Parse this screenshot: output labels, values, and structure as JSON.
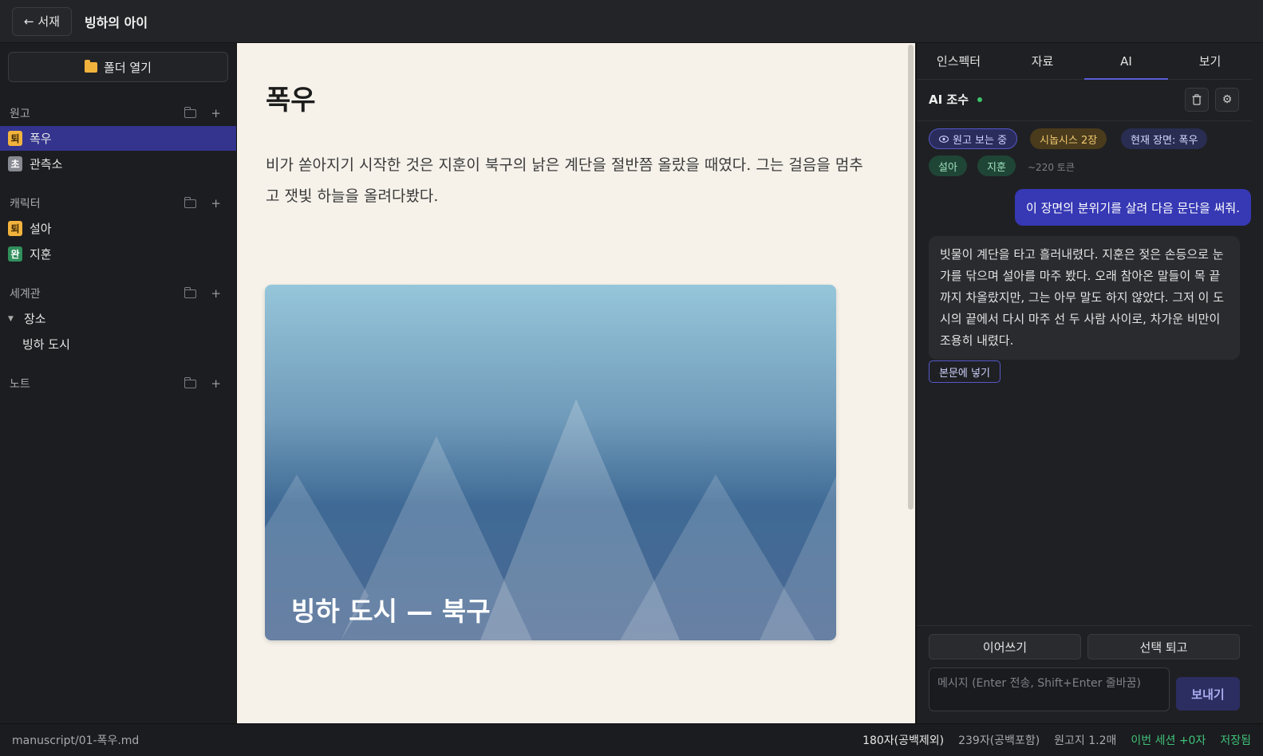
{
  "topbar": {
    "back_label": "← 서재",
    "title": "빙하의 아이"
  },
  "sidebar": {
    "open_folder_label": "폴더 열기",
    "sections": {
      "manuscript": {
        "label": "원고",
        "items": [
          {
            "badge": "퇴",
            "label": "폭우"
          },
          {
            "badge": "초",
            "label": "관측소"
          }
        ]
      },
      "characters": {
        "label": "캐릭터",
        "items": [
          {
            "badge": "퇴",
            "label": "설아"
          },
          {
            "badge": "완",
            "label": "지훈"
          }
        ]
      },
      "world": {
        "label": "세계관",
        "group": "장소",
        "child": "빙하 도시"
      },
      "notes": {
        "label": "노트"
      }
    },
    "plus": "+"
  },
  "editor": {
    "chapter_title": "폭우",
    "paragraph": "비가 쏟아지기 시작한 것은 지훈이 북구의 낡은 계단을 절반쯤 올랐을 때였다. 그는 걸음을 멈추고 잿빛 하늘을 올려다봤다.",
    "image_caption": "빙하 도시 — 북구"
  },
  "rpanel": {
    "tabs": [
      "인스펙터",
      "자료",
      "AI",
      "보기"
    ],
    "active_tab": "AI",
    "ai_title": "AI 조수",
    "chips": {
      "viewing": "원고 보는 중",
      "synopsis": "시놉시스 2장",
      "scene": "현재 장면: 폭우",
      "char1": "설아",
      "char2": "지훈"
    },
    "tokens": "~220 토큰",
    "user_message": "이 장면의 분위기를 살려 다음 문단을 써줘.",
    "ai_message": "빗물이 계단을 타고 흘러내렸다. 지훈은 젖은 손등으로 눈가를 닦으며 설아를 마주 봤다. 오래 참아온 말들이 목 끝까지 차올랐지만, 그는 아무 말도 하지 않았다. 그저 이 도시의 끝에서 다시 마주 선 두 사람 사이로, 차가운 비만이 조용히 내렸다.",
    "insert_label": "본문에 넣기",
    "continue_label": "이어쓰기",
    "revise_label": "선택 퇴고",
    "input_placeholder": "메시지 (Enter 전송, Shift+Enter 줄바꿈)",
    "send_label": "보내기"
  },
  "status": {
    "path": "manuscript/01-폭우.md",
    "chars_no_space": "180자(공백제외)",
    "chars_with_space": "239자(공백포함)",
    "manuscript_pages": "원고지 1.2매",
    "session": "이번 세션 +0자",
    "saved": "저장됨"
  },
  "colors": {
    "accent": "#3638b4",
    "active_item": "#34348f",
    "editor_bg": "#f6f2ea",
    "status_ok": "#3fc27a",
    "badge_draft": "#f2b33d"
  },
  "icons": {
    "folder": "folder-icon",
    "eye": "eye-icon",
    "trash": "trash-icon",
    "gear": "gear-icon",
    "caret": "caret-down-icon"
  }
}
